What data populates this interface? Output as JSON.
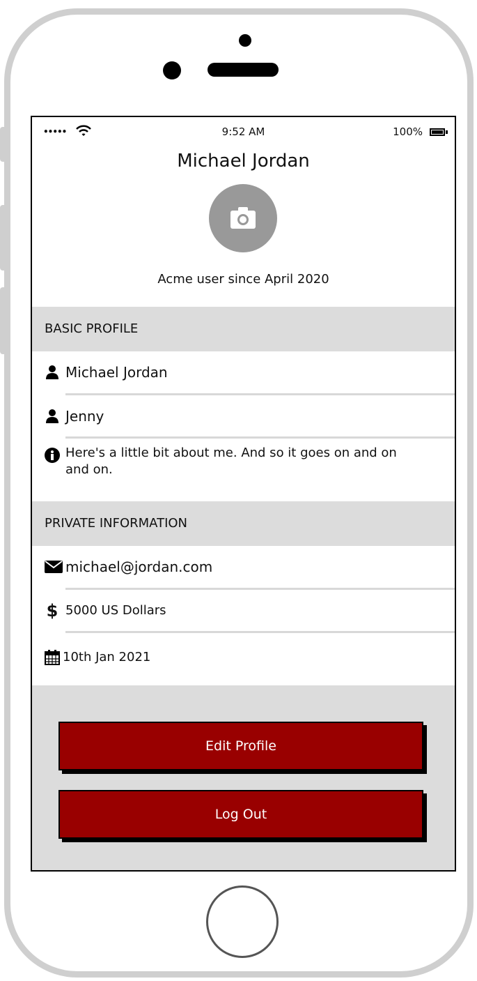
{
  "status_bar": {
    "signal": "•••••",
    "time": "9:52 AM",
    "battery": "100%"
  },
  "profile": {
    "name": "Michael Jordan",
    "since": "Acme user since April 2020"
  },
  "basic_profile": {
    "header": "BASIC PROFILE",
    "full_name": "Michael Jordan",
    "nickname": "Jenny",
    "about": "Here's a little bit about me. And so it goes on and on and on."
  },
  "private_information": {
    "header": "PRIVATE INFORMATION",
    "email": "michael@jordan.com",
    "money": "5000 US Dollars",
    "date": "10th Jan 2021"
  },
  "actions": {
    "edit": "Edit Profile",
    "logout": "Log Out"
  },
  "colors": {
    "button": "#990000",
    "section_bg": "#dcdcdc",
    "avatar_bg": "#999999"
  },
  "icons": [
    "wifi-icon",
    "battery-icon",
    "camera-icon",
    "user-icon",
    "info-icon",
    "envelope-icon",
    "dollar-icon",
    "calendar-icon"
  ]
}
